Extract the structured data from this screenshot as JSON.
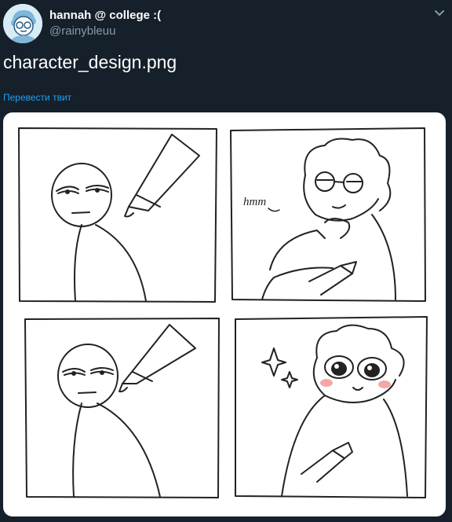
{
  "tweet": {
    "author_name": "hannah @ college :(",
    "author_handle": "@rainybleuu",
    "text": "character_design.png",
    "translate_label": "Перевести твит"
  },
  "comic": {
    "panel2_caption": "hmm"
  },
  "icons": {
    "menu": "chevron-down-icon"
  },
  "colors": {
    "background": "#15202b",
    "link": "#1da1f2",
    "secondary_text": "#8899a6",
    "blush": "#f4a7a7"
  }
}
